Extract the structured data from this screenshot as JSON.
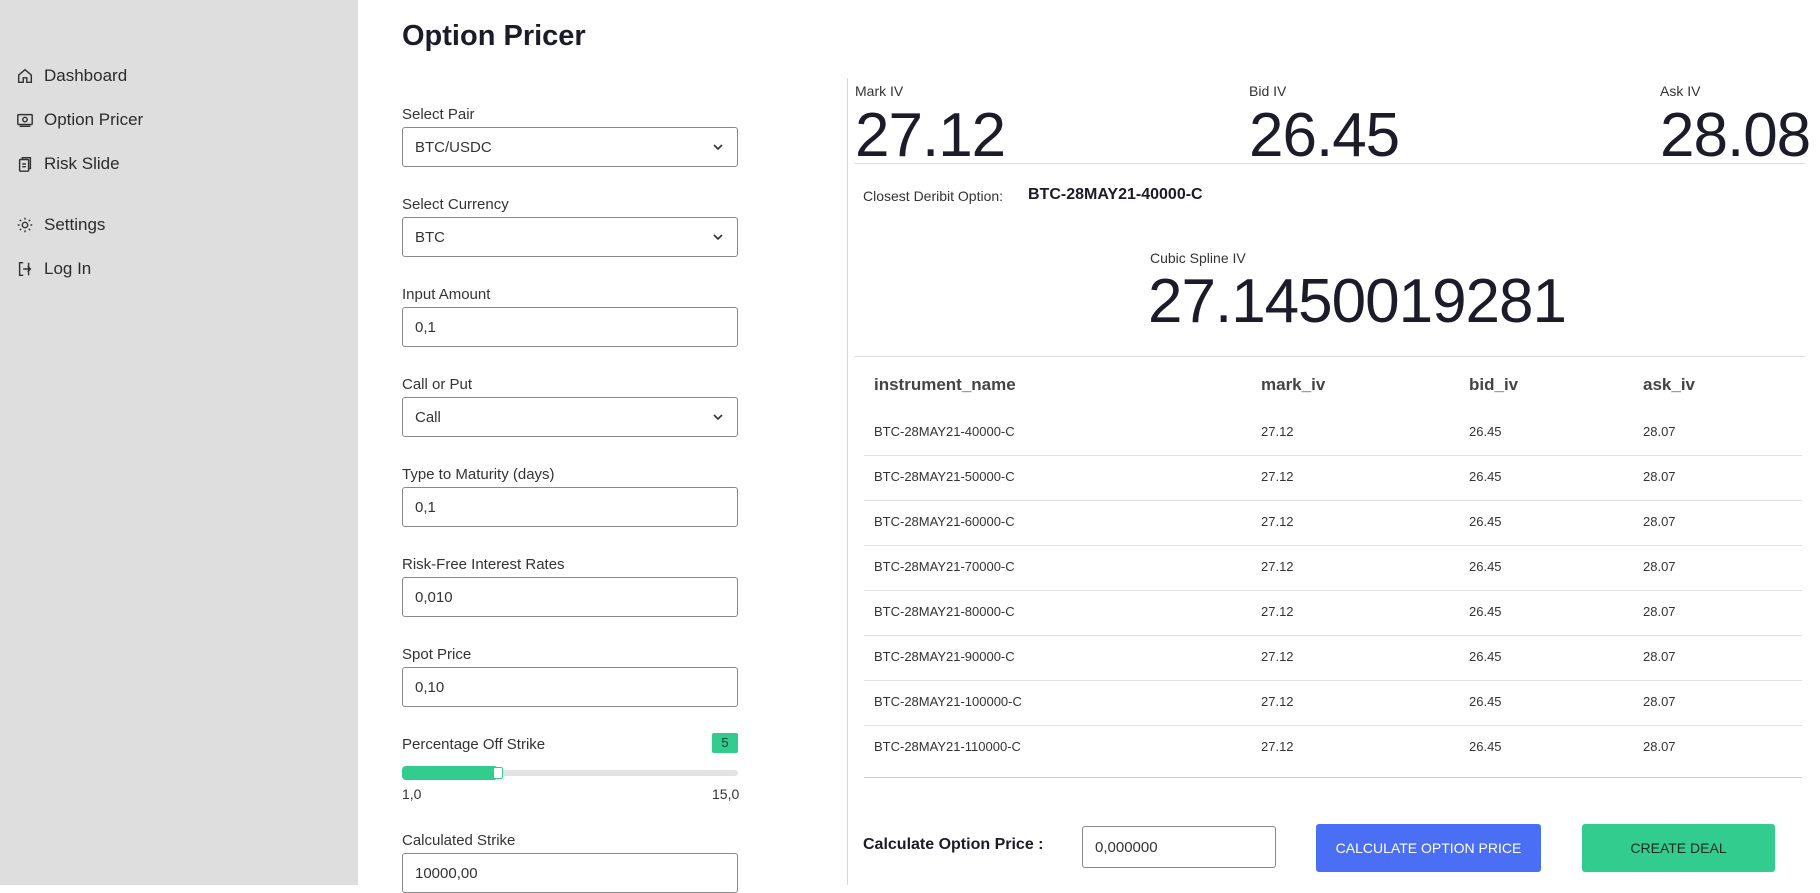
{
  "sidebar": {
    "items": [
      {
        "label": "Dashboard",
        "icon": "home-icon"
      },
      {
        "label": "Option Pricer",
        "icon": "banknote-icon"
      },
      {
        "label": "Risk Slide",
        "icon": "clipboard-icon"
      },
      {
        "label": "Settings",
        "icon": "gear-icon"
      },
      {
        "label": "Log In",
        "icon": "login-icon"
      }
    ]
  },
  "page": {
    "title": "Option Pricer"
  },
  "form": {
    "select_pair": {
      "label": "Select Pair",
      "value": "BTC/USDC"
    },
    "select_currency": {
      "label": "Select Currency",
      "value": "BTC"
    },
    "input_amount": {
      "label": "Input Amount",
      "value": "0,1"
    },
    "call_or_put": {
      "label": "Call or Put",
      "value": "Call"
    },
    "maturity": {
      "label": "Type to Maturity (days)",
      "value": "0,1"
    },
    "risk_free": {
      "label": "Risk-Free Interest Rates",
      "value": "0,010"
    },
    "spot_price": {
      "label": "Spot Price",
      "value": "0,10"
    },
    "percentage_off_strike": {
      "label": "Percentage Off Strike",
      "value": "5",
      "min_label": "1,0",
      "max_label": "15,0",
      "min": 1,
      "max": 15,
      "current": 5
    },
    "calculated_strike": {
      "label": "Calculated Strike",
      "value": "10000,00"
    }
  },
  "iv": {
    "mark": {
      "label": "Mark IV",
      "value": "27.12"
    },
    "bid": {
      "label": "Bid IV",
      "value": "26.45"
    },
    "ask": {
      "label": "Ask IV",
      "value": "28.08"
    }
  },
  "closest": {
    "label": "Closest Deribit Option:",
    "value": "BTC-28MAY21-40000-C"
  },
  "spline": {
    "label": "Cubic Spline IV",
    "value": "27.1450019281"
  },
  "table": {
    "headers": [
      "instrument_name",
      "mark_iv",
      "bid_iv",
      "ask_iv"
    ],
    "rows": [
      [
        "BTC-28MAY21-40000-C",
        "27.12",
        "26.45",
        "28.07"
      ],
      [
        "BTC-28MAY21-50000-C",
        "27.12",
        "26.45",
        "28.07"
      ],
      [
        "BTC-28MAY21-60000-C",
        "27.12",
        "26.45",
        "28.07"
      ],
      [
        "BTC-28MAY21-70000-C",
        "27.12",
        "26.45",
        "28.07"
      ],
      [
        "BTC-28MAY21-80000-C",
        "27.12",
        "26.45",
        "28.07"
      ],
      [
        "BTC-28MAY21-90000-C",
        "27.12",
        "26.45",
        "28.07"
      ],
      [
        "BTC-28MAY21-100000-C",
        "27.12",
        "26.45",
        "28.07"
      ],
      [
        "BTC-28MAY21-110000-C",
        "27.12",
        "26.45",
        "28.07"
      ]
    ]
  },
  "calc": {
    "label": "Calculate Option Price :",
    "value": "0,000000",
    "calc_button": "CALCULATE OPTION PRICE",
    "deal_button": "CREATE DEAL"
  },
  "colors": {
    "accent_green": "#33cc8f",
    "accent_blue": "#4a6ff5",
    "sidebar_bg": "#dedede"
  }
}
